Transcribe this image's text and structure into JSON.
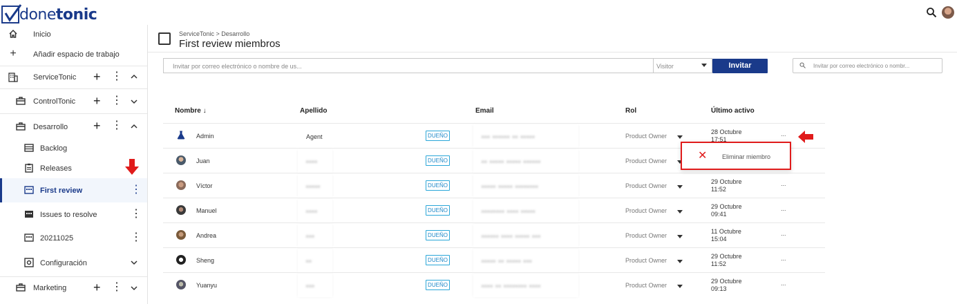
{
  "app": {
    "logo_text_light": "done",
    "logo_text_bold": "tonic"
  },
  "sidebar": {
    "items": [
      {
        "label": "Inicio",
        "icon": "home-icon"
      },
      {
        "label": "Añadir espacio de trabajo",
        "icon": "plus-icon"
      },
      {
        "label": "ServiceTonic",
        "icon": "building-icon",
        "expanded": true
      },
      {
        "label": "ControlTonic",
        "icon": "briefcase-icon",
        "expanded": false
      },
      {
        "label": "Desarrollo",
        "icon": "briefcase-icon",
        "expanded": true
      },
      {
        "label": "Backlog",
        "icon": "list-icon"
      },
      {
        "label": "Releases",
        "icon": "clipboard-icon"
      },
      {
        "label": "First review",
        "icon": "board-icon",
        "active": true
      },
      {
        "label": "Issues to resolve",
        "icon": "board-icon"
      },
      {
        "label": "20211025",
        "icon": "board-icon"
      },
      {
        "label": "Configuración",
        "icon": "settings-icon"
      },
      {
        "label": "Marketing",
        "icon": "briefcase-icon",
        "expanded": false
      }
    ]
  },
  "header": {
    "breadcrumb": "ServiceTonic > Desarrollo",
    "title": "First review miembros"
  },
  "invite": {
    "placeholder": "Invitar por correo electrónico o nombre de us...",
    "role_value": "Visitor",
    "button_label": "Invitar",
    "search_placeholder": "Invitar por correo electrónico o nombr..."
  },
  "table": {
    "columns": [
      "Nombre",
      "Apellido",
      "Email",
      "Rol",
      "Último activo"
    ],
    "rows": [
      {
        "nombre": "Admin",
        "apellido": "Agent",
        "badge": "DUEÑO",
        "email": "▪▪▪ ▪▪▪▪▪▪ ▪▪ ▪▪▪▪▪",
        "rol": "Product Owner",
        "date1": "28 Octubre",
        "date2": "17:51",
        "avatar": "flask"
      },
      {
        "nombre": "Juan",
        "apellido": "▪▪▪▪",
        "badge": "DUEÑO",
        "email": "▪▪ ▪▪▪▪▪ ▪▪▪▪▪ ▪▪▪▪▪▪",
        "rol": "Product Owner",
        "date1": "",
        "date2": "",
        "avatar": "photo1"
      },
      {
        "nombre": "Víctor",
        "apellido": "▪▪▪▪▪",
        "badge": "DUEÑO",
        "email": "▪▪▪▪▪ ▪▪▪▪▪ ▪▪▪▪▪▪▪▪",
        "rol": "Product Owner",
        "date1": "29 Octubre",
        "date2": "11:52",
        "avatar": "photo2"
      },
      {
        "nombre": "Manuel",
        "apellido": "▪▪▪▪",
        "badge": "DUEÑO",
        "email": "▪▪▪▪▪▪▪▪ ▪▪▪▪ ▪▪▪▪▪",
        "rol": "Product Owner",
        "date1": "29 Octubre",
        "date2": "09:41",
        "avatar": "photo3"
      },
      {
        "nombre": "Andrea",
        "apellido": "▪▪▪",
        "badge": "DUEÑO",
        "email": "▪▪▪▪▪▪ ▪▪▪▪ ▪▪▪▪▪ ▪▪▪",
        "rol": "Product Owner",
        "date1": "11 Octubre",
        "date2": "15:04",
        "avatar": "photo4"
      },
      {
        "nombre": "Sheng",
        "apellido": "▪▪",
        "badge": "DUEÑO",
        "email": "▪▪▪▪▪ ▪▪ ▪▪▪▪▪ ▪▪▪",
        "rol": "Product Owner",
        "date1": "29 Octubre",
        "date2": "11:52",
        "avatar": "photo5"
      },
      {
        "nombre": "Yuanyu",
        "apellido": "▪▪▪",
        "badge": "DUEÑO",
        "email": "▪▪▪▪ ▪▪ ▪▪▪▪▪▪▪▪ ▪▪▪▪",
        "rol": "Product Owner",
        "date1": "29 Octubre",
        "date2": "09:13",
        "avatar": "photo6"
      }
    ],
    "more_label": "...",
    "sort_indicator": "↓"
  },
  "popover": {
    "label": "Eliminar miembro"
  },
  "colors": {
    "brand": "#1a3a8a",
    "badge": "#29a6d8",
    "alert": "#e01b1b"
  }
}
